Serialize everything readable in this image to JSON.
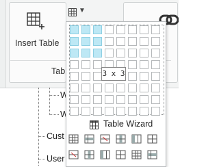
{
  "ribbon": {
    "insert_table_label": "Insert Table",
    "group_label": "Tab",
    "icons": {
      "insert": "insert-table-icon",
      "table_dropdown": "table-grid-icon",
      "caret": "chevron-down-icon",
      "link": "link-icon"
    }
  },
  "tree": {
    "items": [
      {
        "label": "W"
      },
      {
        "label": "W"
      },
      {
        "label": "Cust"
      },
      {
        "label": "User"
      }
    ]
  },
  "table_picker": {
    "rows": 8,
    "cols": 8,
    "selected_rows": 3,
    "selected_cols": 3,
    "size_label": "3 x 3",
    "wizard_label": "Table Wizard",
    "wizard_icon": "table-wizard-icon"
  },
  "tools": {
    "row1": [
      "table-properties-icon",
      "table-row-properties-icon",
      "delete-row-icon",
      "insert-column-icon",
      "insert-column-right-icon",
      "split-cells-icon"
    ],
    "row2": [
      "insert-column-left-icon",
      "insert-row-icon",
      "merge-cells-icon",
      "align-table-icon",
      "delete-table-icon",
      "edit-table-icon"
    ]
  },
  "colors": {
    "selected_cell": "#bde8f5",
    "cell_border": "#b5b8ba",
    "ribbon_bg": "#f3f4f4"
  }
}
